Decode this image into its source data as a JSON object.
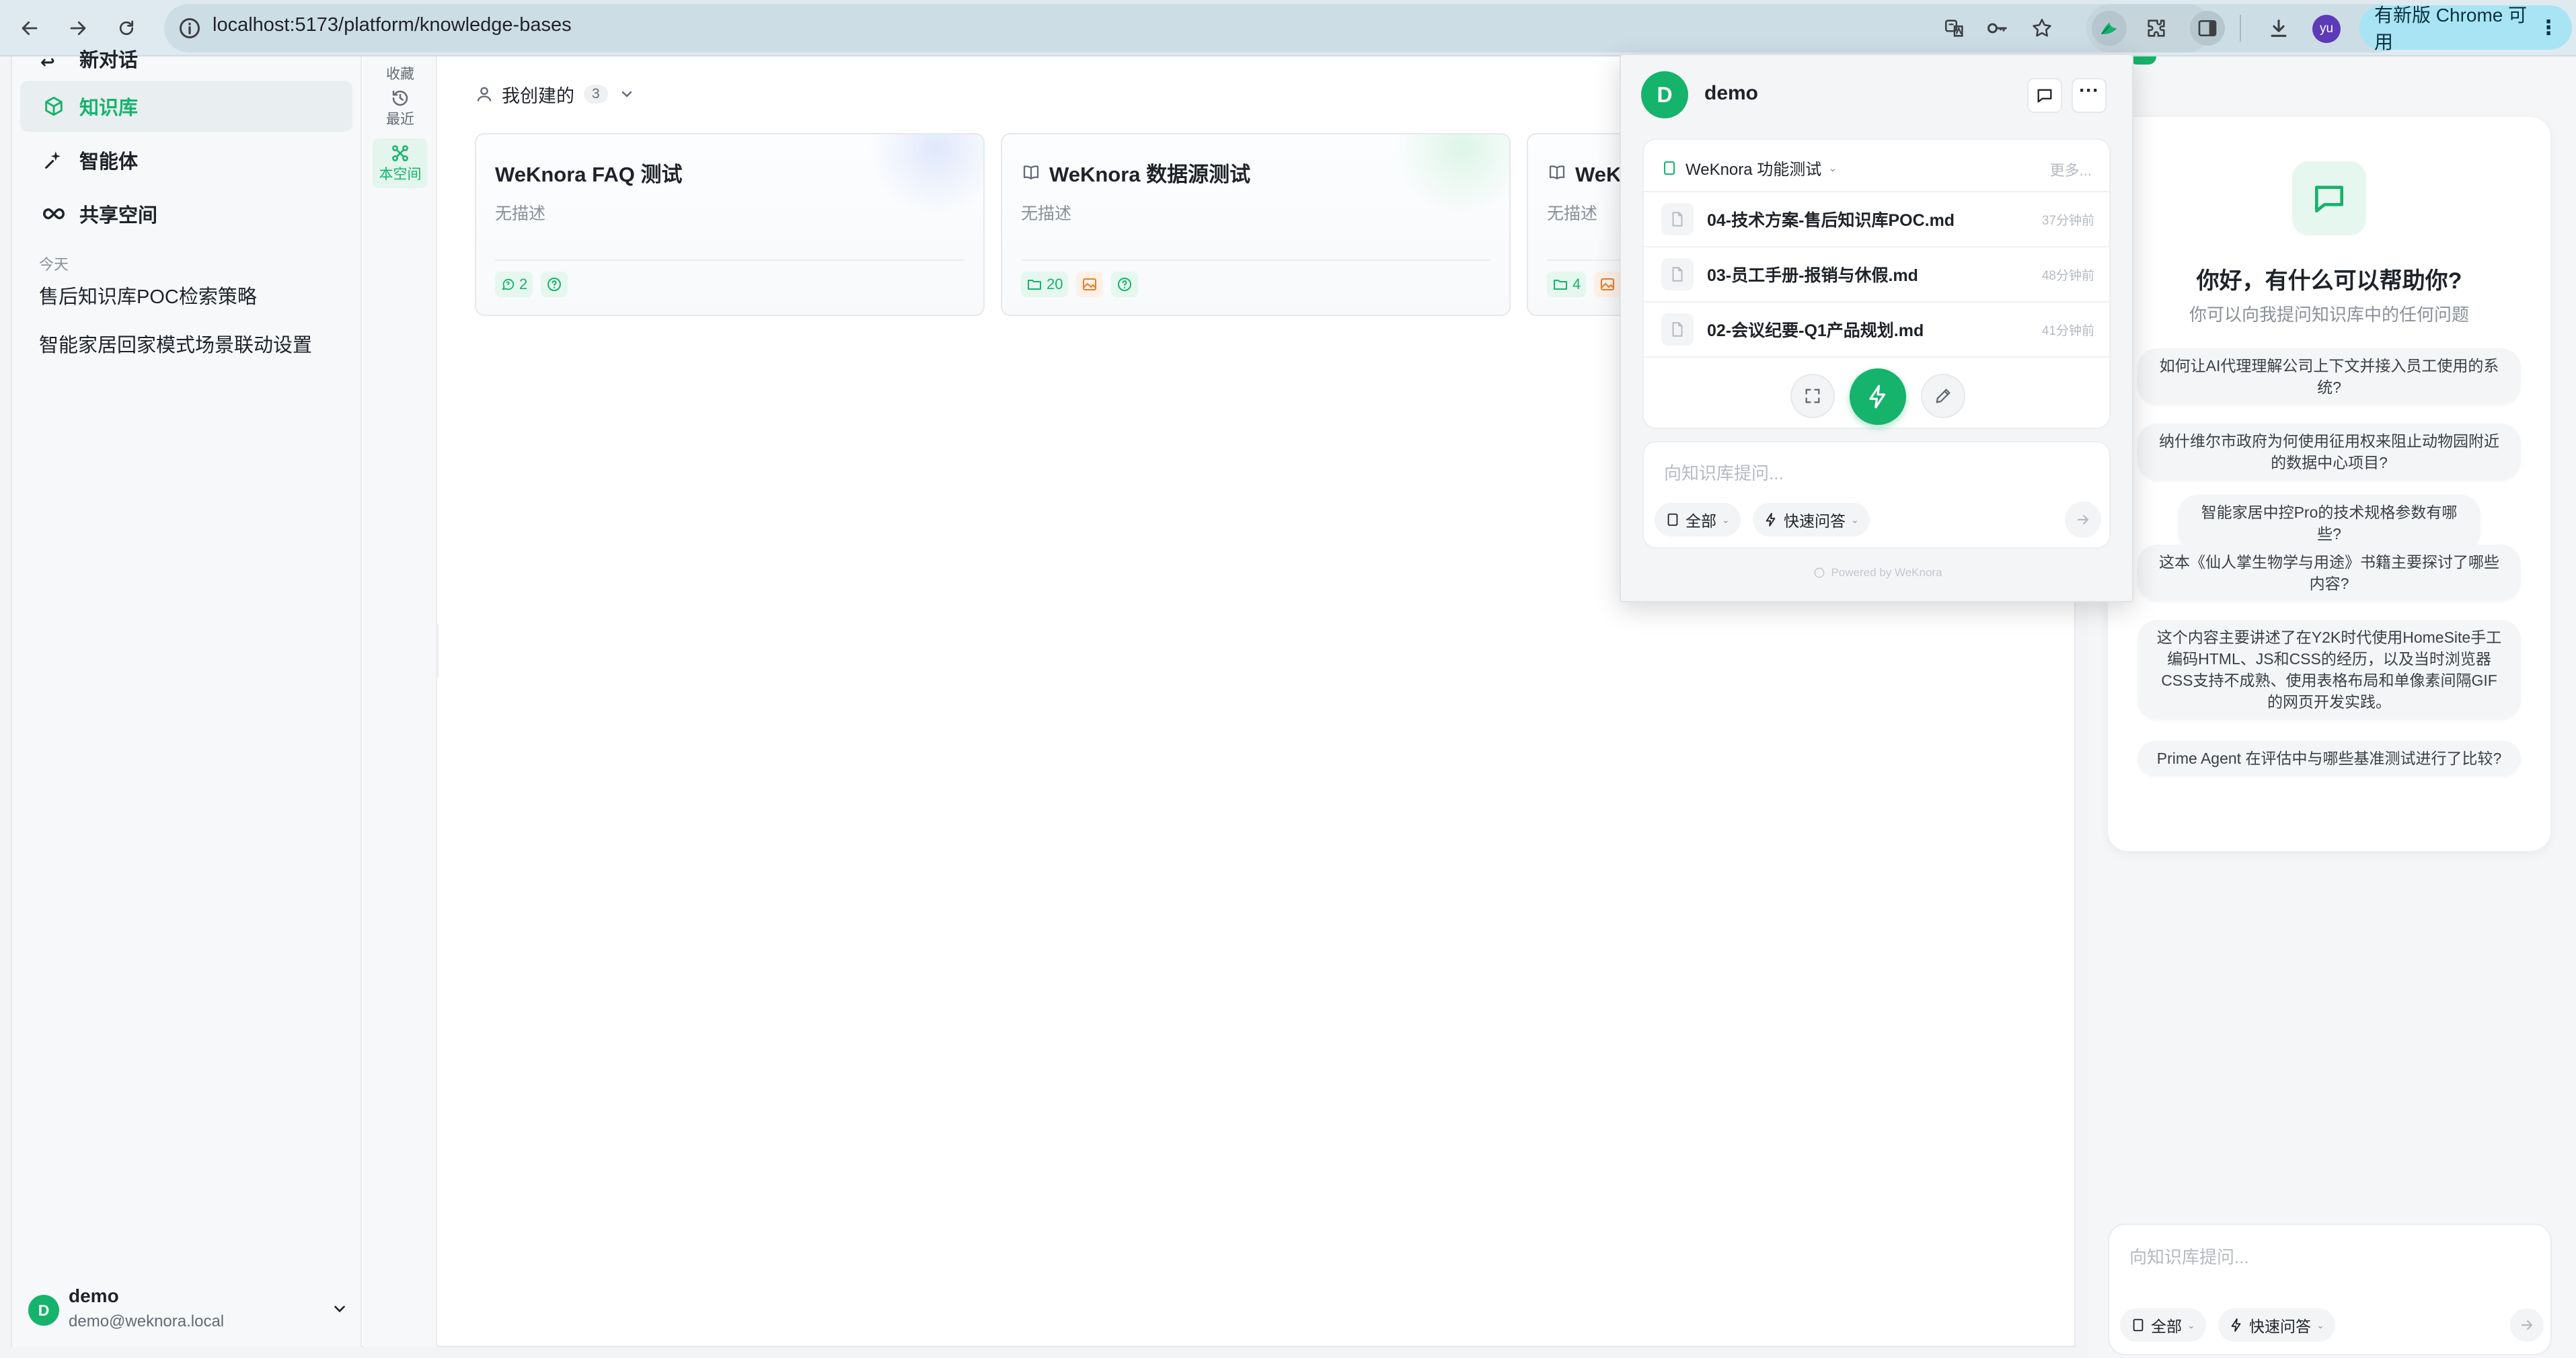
{
  "browser": {
    "url": "localhost:5173/platform/knowledge-bases",
    "update_label": "有新版 Chrome 可用",
    "profile_initials": "yu"
  },
  "sidebar": {
    "partial_item_label": "新对话",
    "items": [
      {
        "label": "知识库",
        "icon": "cube-icon",
        "active": true
      },
      {
        "label": "智能体",
        "icon": "sparkle-icon",
        "active": false
      },
      {
        "label": "共享空间",
        "icon": "infinity-icon",
        "active": false
      }
    ],
    "history_section": "今天",
    "history": [
      "售后知识库POC检索策略",
      "智能家居回家模式场景联动设置"
    ],
    "user": {
      "avatar": "D",
      "name": "demo",
      "email": "demo@weknora.local"
    }
  },
  "subnav": {
    "items": [
      {
        "label": "收藏",
        "icon": "star-icon"
      },
      {
        "label": "最近",
        "icon": "history-icon"
      },
      {
        "label": "本空间",
        "icon": "network-icon",
        "active": true
      }
    ]
  },
  "filter": {
    "label": "我创建的",
    "count": "3"
  },
  "kb_cards": [
    {
      "title": "WeKnora FAQ 测试",
      "desc": "无描述",
      "count": "2",
      "kind": "faq"
    },
    {
      "title": "WeKnora 数据源测试",
      "desc": "无描述",
      "count": "20",
      "kind": "docs"
    },
    {
      "title": "WeKnora 功能测试",
      "desc": "无描述",
      "count": "4",
      "kind": "docs"
    }
  ],
  "popup": {
    "avatar": "D",
    "user": "demo",
    "kb_name": "WeKnora 功能测试",
    "more_label": "更多...",
    "files": [
      {
        "name": "04-技术方案-售后知识库POC.md",
        "time": "37分钟前"
      },
      {
        "name": "03-员工手册-报销与休假.md",
        "time": "48分钟前"
      },
      {
        "name": "02-会议纪要-Q1产品规划.md",
        "time": "41分钟前"
      }
    ],
    "input_placeholder": "向知识库提问...",
    "scope_label": "全部",
    "mode_label": "快速问答",
    "powered": "Powered by WeKnora"
  },
  "chat_panel": {
    "heading": "你好，有什么可以帮助你?",
    "subheading": "你可以向我提问知识库中的任何问题",
    "suggestions": [
      "如何让AI代理理解公司上下文并接入员工使用的系统?",
      "纳什维尔市政府为何使用征用权来阻止动物园附近的数据中心项目?",
      "智能家居中控Pro的技术规格参数有哪些?",
      "这本《仙人掌生物学与用途》书籍主要探讨了哪些内容?",
      "这个内容主要讲述了在Y2K时代使用HomeSite手工编码HTML、JS和CSS的经历，以及当时浏览器CSS支持不成熟、使用表格布局和单像素间隔GIF的网页开发实践。",
      "Prime Agent 在评估中与哪些基准测试进行了比较?"
    ],
    "input_placeholder": "向知识库提问...",
    "scope_label": "全部",
    "mode_label": "快速问答"
  },
  "colors": {
    "brand": "#15b36b",
    "orange": "#ef7b2a"
  }
}
